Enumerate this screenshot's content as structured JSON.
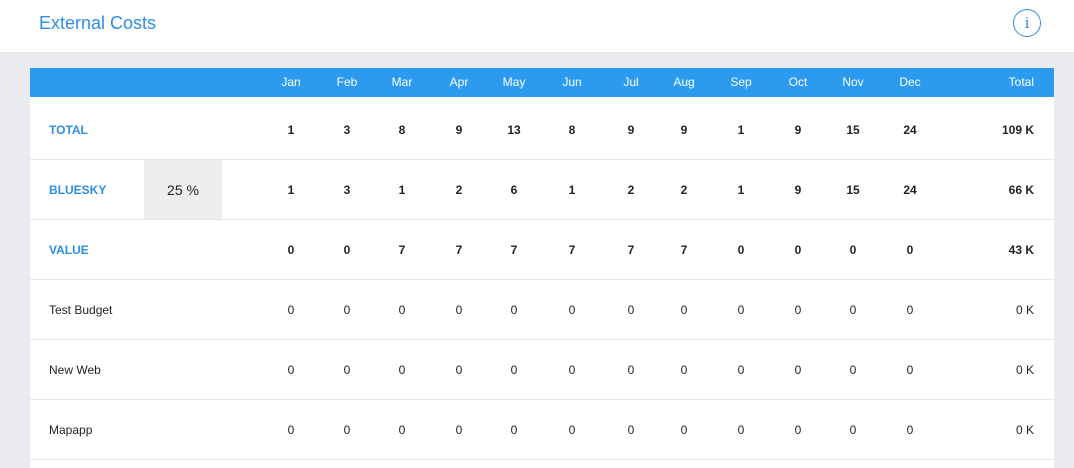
{
  "header": {
    "title": "External Costs",
    "info_icon_glyph": "i"
  },
  "table": {
    "months": [
      "Jan",
      "Feb",
      "Mar",
      "Apr",
      "May",
      "Jun",
      "Jul",
      "Aug",
      "Sep",
      "Oct",
      "Nov",
      "Dec"
    ],
    "total_header": "Total",
    "rows": [
      {
        "label": "TOTAL",
        "summary": true,
        "values": [
          "1",
          "3",
          "8",
          "9",
          "13",
          "8",
          "9",
          "9",
          "1",
          "9",
          "15",
          "24"
        ],
        "total": "109 K"
      },
      {
        "label": "BLUESKY",
        "summary": true,
        "percent": "25 %",
        "values": [
          "1",
          "3",
          "1",
          "2",
          "6",
          "1",
          "2",
          "2",
          "1",
          "9",
          "15",
          "24"
        ],
        "total": "66 K"
      },
      {
        "label": "VALUE",
        "summary": true,
        "values": [
          "0",
          "0",
          "7",
          "7",
          "7",
          "7",
          "7",
          "7",
          "0",
          "0",
          "0",
          "0"
        ],
        "total": "43 K"
      },
      {
        "label": "Test Budget",
        "summary": false,
        "values": [
          "0",
          "0",
          "0",
          "0",
          "0",
          "0",
          "0",
          "0",
          "0",
          "0",
          "0",
          "0"
        ],
        "total": "0 K"
      },
      {
        "label": "New Web",
        "summary": false,
        "values": [
          "0",
          "0",
          "0",
          "0",
          "0",
          "0",
          "0",
          "0",
          "0",
          "0",
          "0",
          "0"
        ],
        "total": "0 K"
      },
      {
        "label": "Mapapp",
        "summary": false,
        "values": [
          "0",
          "0",
          "0",
          "0",
          "0",
          "0",
          "0",
          "0",
          "0",
          "0",
          "0",
          "0"
        ],
        "total": "0 K"
      }
    ]
  },
  "colors": {
    "accent": "#2d8ee6",
    "header_bar": "#2c9aef",
    "page_bg": "#e9ebee"
  }
}
